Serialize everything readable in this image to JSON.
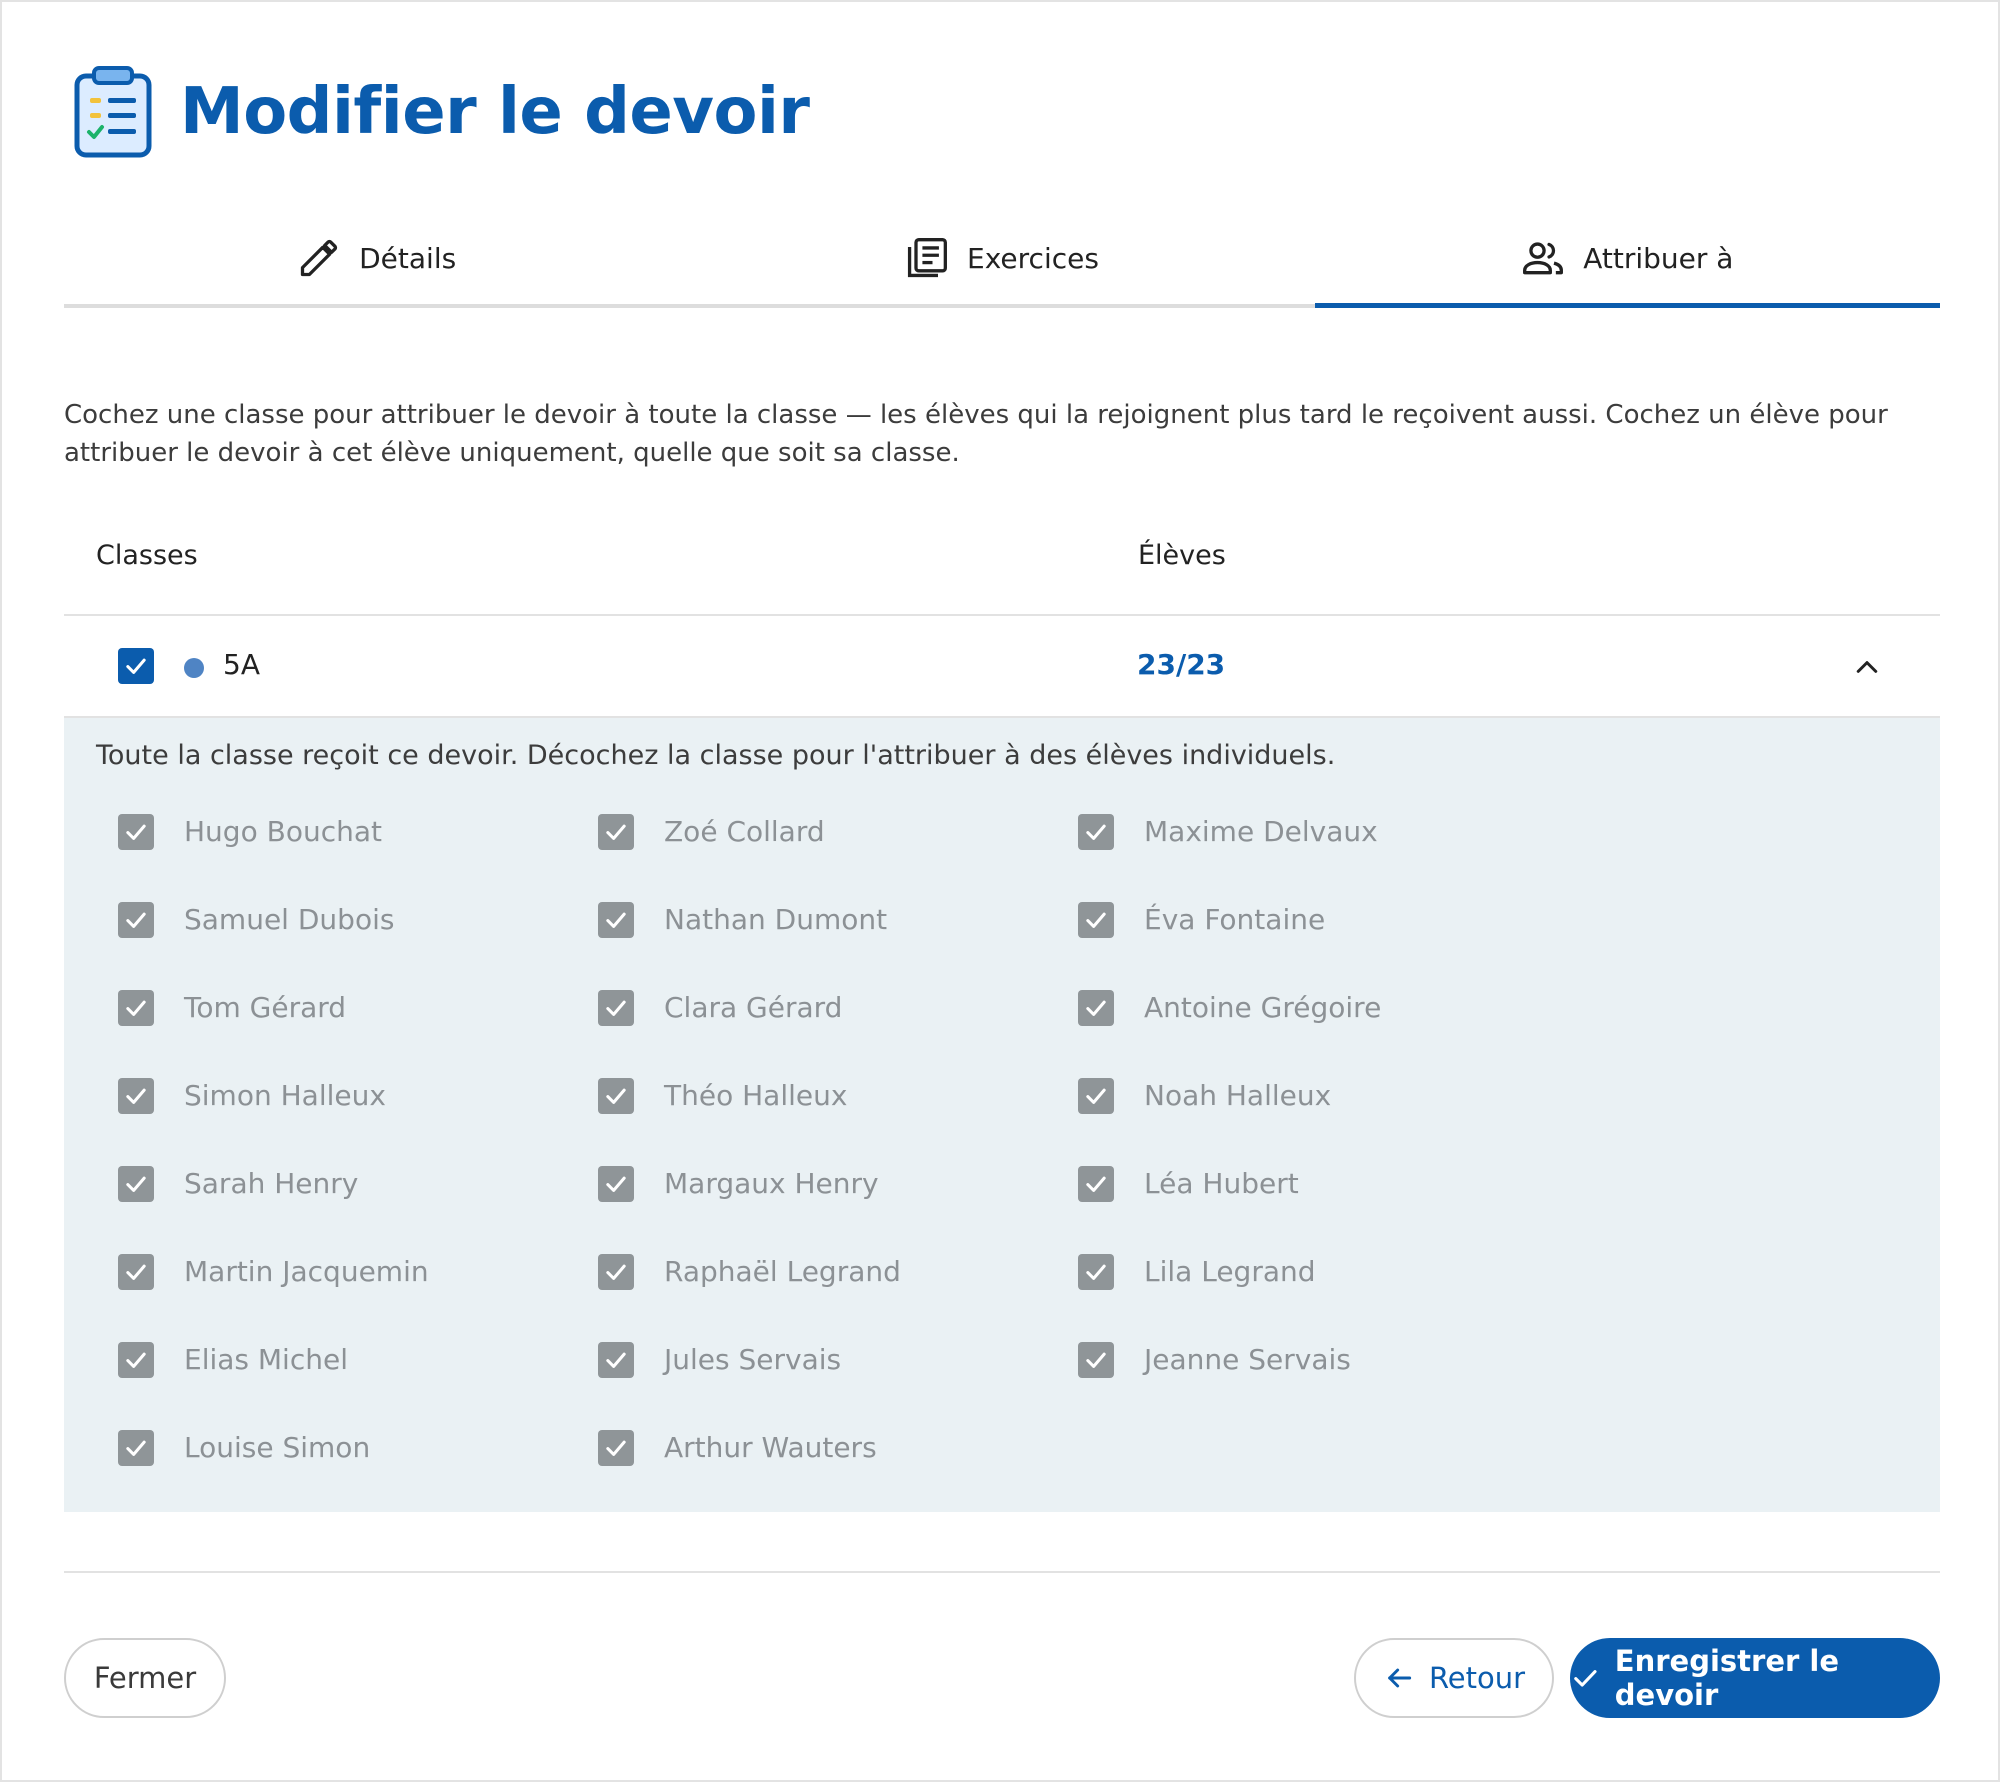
{
  "header": {
    "title": "Modifier le devoir",
    "icon": "clipboard-checklist-icon"
  },
  "tabs": [
    {
      "label": "Détails",
      "icon": "pencil-icon",
      "active": false
    },
    {
      "label": "Exercices",
      "icon": "document-list-icon",
      "active": false
    },
    {
      "label": "Attribuer à",
      "icon": "users-icon",
      "active": true
    }
  ],
  "description": "Cochez une classe pour attribuer le devoir à toute la classe — les élèves qui la rejoignent plus tard le reçoivent aussi. Cochez un élève pour attribuer le devoir à cet élève uniquement, quelle que soit sa classe.",
  "table": {
    "col_classes": "Classes",
    "col_eleves": "Élèves"
  },
  "class_row": {
    "name": "5A",
    "count": "23/23",
    "checked": true,
    "dot_color": "#4f84c4",
    "expanded": true
  },
  "panel": {
    "note": "Toute la classe reçoit ce devoir. Décochez la classe pour l'attribuer à des élèves individuels.",
    "students": [
      "Hugo Bouchat",
      "Zoé Collard",
      "Maxime Delvaux",
      "Samuel Dubois",
      "Nathan Dumont",
      "Éva Fontaine",
      "Tom Gérard",
      "Clara Gérard",
      "Antoine Grégoire",
      "Simon Halleux",
      "Théo Halleux",
      "Noah Halleux",
      "Sarah Henry",
      "Margaux Henry",
      "Léa Hubert",
      "Martin Jacquemin",
      "Raphaël Legrand",
      "Lila Legrand",
      "Elias Michel",
      "Jules Servais",
      "Jeanne Servais",
      "Louise Simon",
      "Arthur Wauters"
    ]
  },
  "footer": {
    "close_label": "Fermer",
    "back_label": "Retour",
    "save_label": "Enregistrer le devoir"
  },
  "colors": {
    "primary": "#0b5cad",
    "panel_bg": "#eaf1f4",
    "disabled_check": "#8f9598"
  }
}
